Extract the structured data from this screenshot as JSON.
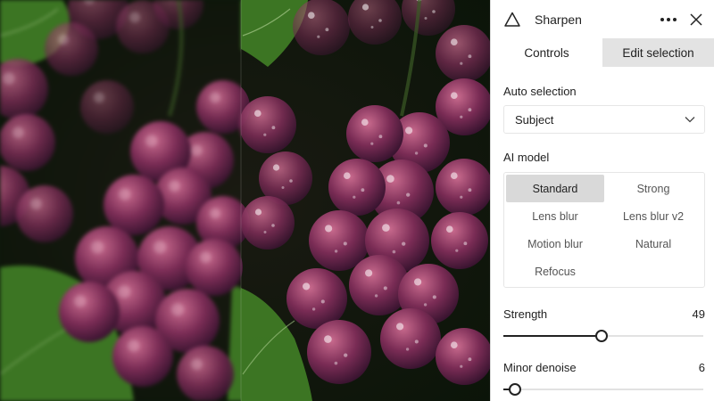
{
  "panel": {
    "title": "Sharpen",
    "icons": {
      "tool": "triangle-icon",
      "more": "more-horizontal-icon",
      "close": "close-icon"
    },
    "tabs": [
      {
        "label": "Controls",
        "active": true
      },
      {
        "label": "Edit selection",
        "active": false
      }
    ],
    "auto_selection": {
      "label": "Auto selection",
      "value": "Subject",
      "icon": "chevron-down-icon"
    },
    "ai_model": {
      "label": "AI model",
      "options": [
        "Standard",
        "Strong",
        "Lens blur",
        "Lens blur v2",
        "Motion blur",
        "Natural",
        "Refocus"
      ],
      "selected": "Standard"
    },
    "strength": {
      "label": "Strength",
      "value": "49",
      "level": 0.49
    },
    "minor_denoise": {
      "label": "Minor denoise",
      "value": "6",
      "level": 0.06
    }
  },
  "preview": {
    "left_side": "before (blurred)",
    "right_side": "after (sharpened)"
  },
  "colors": {
    "grape_dark": "#3a1430",
    "grape_mid": "#7a2c55",
    "grape_light": "#c86a8d",
    "leaf": "#3f7a25",
    "selected_option_bg": "#d9d9d9",
    "inactive_tab_bg": "#e3e3e3"
  }
}
